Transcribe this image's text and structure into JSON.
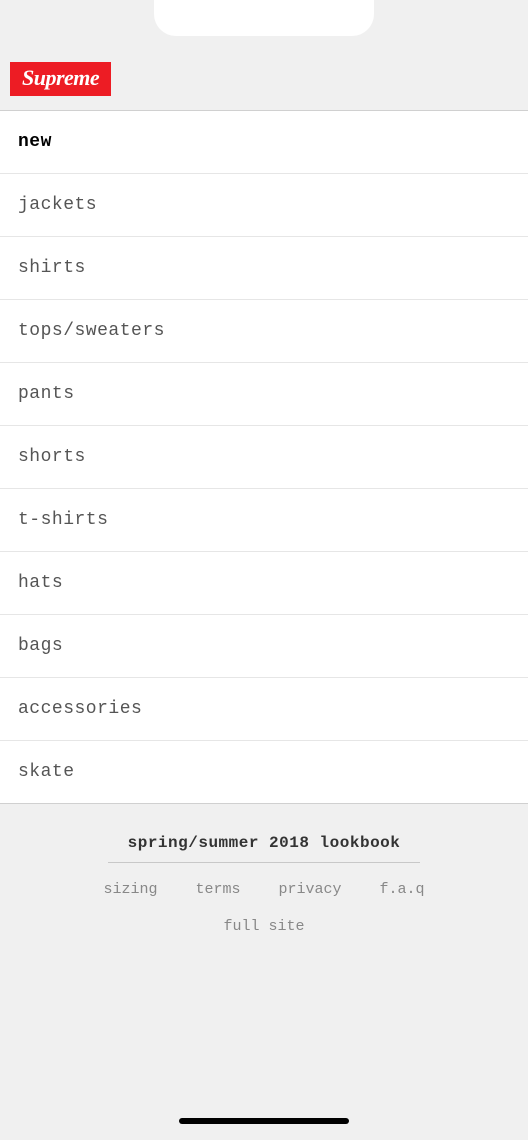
{
  "header": {
    "logo_text": "Supreme"
  },
  "categories": [
    {
      "label": "new",
      "active": true
    },
    {
      "label": "jackets",
      "active": false
    },
    {
      "label": "shirts",
      "active": false
    },
    {
      "label": "tops/sweaters",
      "active": false
    },
    {
      "label": "pants",
      "active": false
    },
    {
      "label": "shorts",
      "active": false
    },
    {
      "label": "t-shirts",
      "active": false
    },
    {
      "label": "hats",
      "active": false
    },
    {
      "label": "bags",
      "active": false
    },
    {
      "label": "accessories",
      "active": false
    },
    {
      "label": "skate",
      "active": false
    }
  ],
  "footer": {
    "title": "spring/summer 2018 lookbook",
    "links": [
      {
        "label": "sizing"
      },
      {
        "label": "terms"
      },
      {
        "label": "privacy"
      },
      {
        "label": "f.a.q"
      }
    ],
    "fullsite": "full site"
  }
}
